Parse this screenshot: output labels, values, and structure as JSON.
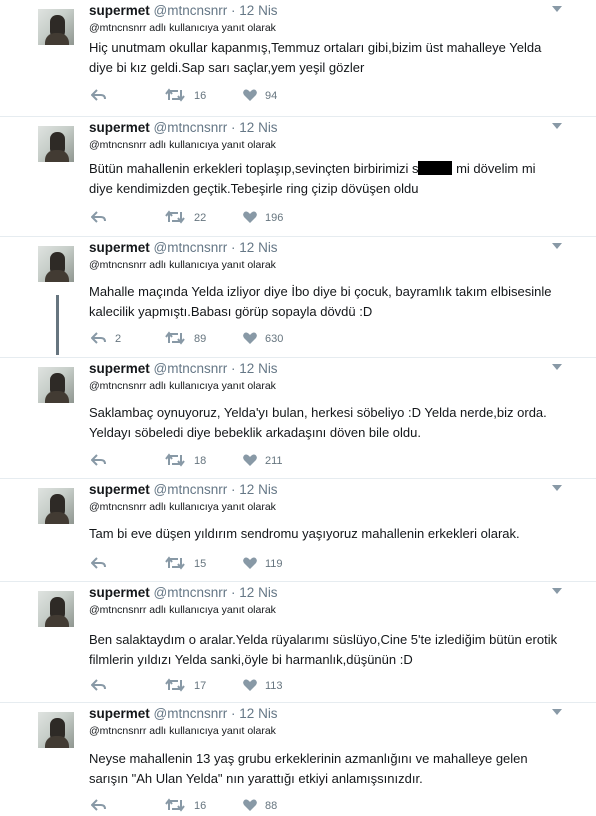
{
  "tweets": [
    {
      "name": "supermet",
      "handle": "@mtncnsnrr",
      "sep": "·",
      "date": "12 Nis",
      "reply_user": "@mtncnsnrr",
      "reply_suffix": "adlı kullanıcıya yanıt olarak",
      "lines": [
        "Hiç unutmam okullar kapanmış,Temmuz ortaları gibi,bizim üst mahalleye Yelda",
        "diye bi kız geldi.Sap sarı saçlar,yem yeşil gözler"
      ],
      "replies": "",
      "retweets": "16",
      "likes": "94"
    },
    {
      "name": "supermet",
      "handle": "@mtncnsnrr",
      "sep": "·",
      "date": "12 Nis",
      "reply_user": "@mtncnsnrr",
      "reply_suffix": "adlı kullanıcıya yanıt olarak",
      "line1_a": "Bütün mahallenin erkekleri toplaşıp,sevinçten birbirimizi s",
      "line1_b": " mi dövelim mi",
      "lines": [
        "diye kendimizden geçtik.Tebeşirle ring çizip dövüşen oldu"
      ],
      "replies": "",
      "retweets": "22",
      "likes": "196"
    },
    {
      "name": "supermet",
      "handle": "@mtncnsnrr",
      "sep": "·",
      "date": "12 Nis",
      "reply_user": "@mtncnsnrr",
      "reply_suffix": "adlı kullanıcıya yanıt olarak",
      "lines": [
        "Mahalle maçında Yelda izliyor diye İbo diye bi çocuk, bayramlık takım elbisesinle",
        "kalecilik yapmıştı.Babası görüp sopayla dövdü :D"
      ],
      "replies": "2",
      "retweets": "89",
      "likes": "630"
    },
    {
      "name": "supermet",
      "handle": "@mtncnsnrr",
      "sep": "·",
      "date": "12 Nis",
      "reply_user": "@mtncnsnrr",
      "reply_suffix": "adlı kullanıcıya yanıt olarak",
      "lines": [
        "Saklambaç oynuyoruz, Yelda'yı bulan, herkesi söbeliyo :D Yelda nerde,biz orda.",
        "Yeldayı söbeledi diye bebeklik arkadaşını döven bile oldu."
      ],
      "replies": "",
      "retweets": "18",
      "likes": "211"
    },
    {
      "name": "supermet",
      "handle": "@mtncnsnrr",
      "sep": "·",
      "date": "12 Nis",
      "reply_user": "@mtncnsnrr",
      "reply_suffix": "adlı kullanıcıya yanıt olarak",
      "lines": [
        "Tam bi eve düşen yıldırım sendromu yaşıyoruz mahallenin erkekleri olarak."
      ],
      "replies": "",
      "retweets": "15",
      "likes": "119"
    },
    {
      "name": "supermet",
      "handle": "@mtncnsnrr",
      "sep": "·",
      "date": "12 Nis",
      "reply_user": "@mtncnsnrr",
      "reply_suffix": "adlı kullanıcıya yanıt olarak",
      "lines": [
        "Ben salaktaydım o aralar.Yelda rüyalarımı süslüyo,Cine 5'te izlediğim bütün erotik",
        "filmlerin yıldızı Yelda sanki,öyle bi harmanlık,düşünün :D"
      ],
      "replies": "",
      "retweets": "17",
      "likes": "113"
    },
    {
      "name": "supermet",
      "handle": "@mtncnsnrr",
      "sep": "·",
      "date": "12 Nis",
      "reply_user": "@mtncnsnrr",
      "reply_suffix": "adlı kullanıcıya yanıt olarak",
      "lines": [
        "Neyse mahallenin 13 yaş grubu erkeklerinin azmanlığını ve mahalleye gelen",
        "sarışın \"Ah Ulan Yelda\" nın yarattığı etkiyi anlamışsınızdır."
      ],
      "replies": "",
      "retweets": "16",
      "likes": "88"
    }
  ],
  "colors": {
    "text": "#14171a",
    "muted": "#657786",
    "icon": "#8899a6",
    "divider": "#e6ecf0",
    "thread_line": "#66757f"
  }
}
